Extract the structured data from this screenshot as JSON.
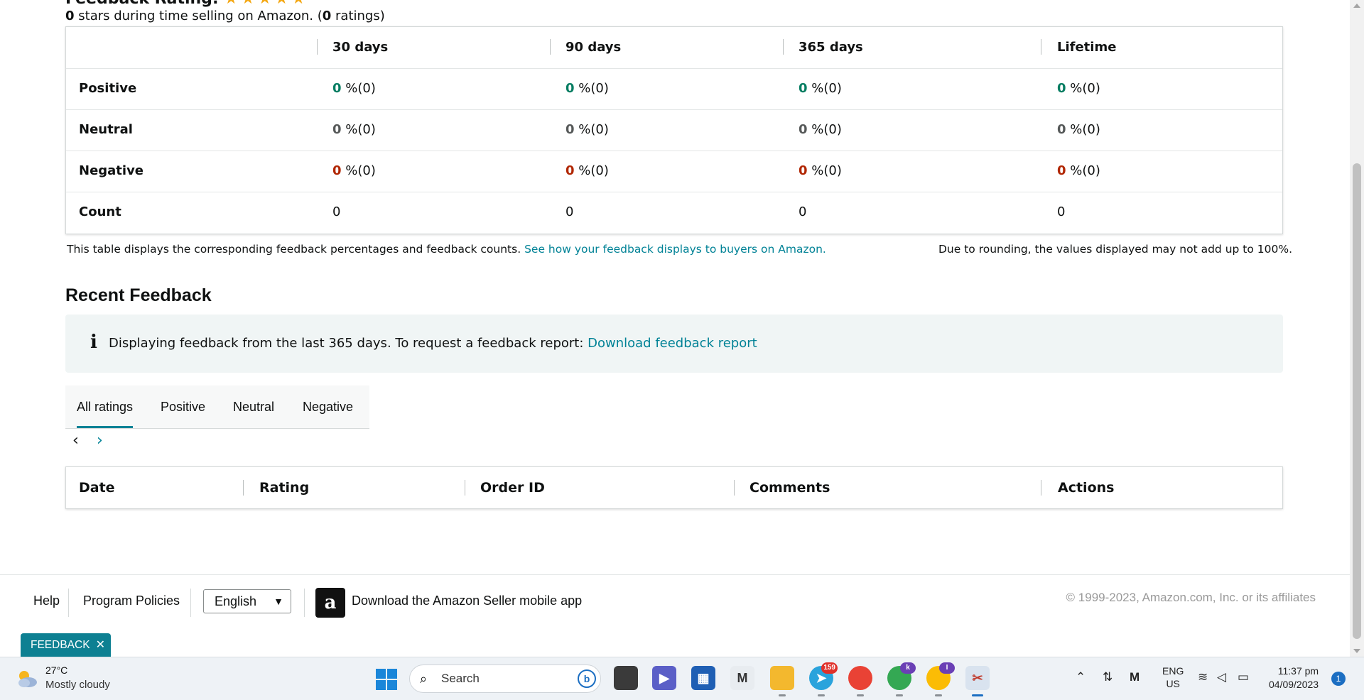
{
  "rating": {
    "title": "Feedback Rating:",
    "stars": "★★★★★",
    "stars_value": 0,
    "summary_count": "0",
    "summary_text1": " stars during time selling on Amazon. (",
    "summary_ratings": "0",
    "summary_text2": " ratings)"
  },
  "feedback_table": {
    "headers": [
      "30 days",
      "90 days",
      "365 days",
      "Lifetime"
    ],
    "rows": [
      {
        "label": "Positive",
        "cells": [
          {
            "v": "0",
            "s": " %(0)"
          },
          {
            "v": "0",
            "s": " %(0)"
          },
          {
            "v": "0",
            "s": " %(0)"
          },
          {
            "v": "0",
            "s": " %(0)"
          }
        ]
      },
      {
        "label": "Neutral",
        "cells": [
          {
            "v": "0",
            "s": " %(0)"
          },
          {
            "v": "0",
            "s": " %(0)"
          },
          {
            "v": "0",
            "s": " %(0)"
          },
          {
            "v": "0",
            "s": " %(0)"
          }
        ]
      },
      {
        "label": "Negative",
        "cells": [
          {
            "v": "0",
            "s": " %(0)"
          },
          {
            "v": "0",
            "s": " %(0)"
          },
          {
            "v": "0",
            "s": " %(0)"
          },
          {
            "v": "0",
            "s": " %(0)"
          }
        ]
      },
      {
        "label": "Count",
        "cells": [
          "0",
          "0",
          "0",
          "0"
        ]
      }
    ],
    "note": "This table displays the corresponding feedback percentages and feedback counts. ",
    "note_link": "See how your feedback displays to buyers on Amazon.",
    "rounding_note": "Due to rounding, the values displayed may not add up to 100%."
  },
  "recent": {
    "title": "Recent Feedback",
    "info_icon": "i",
    "info_text": "Displaying feedback from the last 365 days. To request a feedback report: ",
    "info_link": "Download feedback report",
    "tabs": [
      "All ratings",
      "Positive",
      "Neutral",
      "Negative"
    ],
    "prev": "‹",
    "next": "›",
    "columns": [
      "Date",
      "Rating",
      "Order ID",
      "Comments",
      "Actions"
    ]
  },
  "footer": {
    "help": "Help",
    "policies": "Program Policies",
    "language": "English",
    "app_logo": "a",
    "app_text": "Download the Amazon Seller mobile app",
    "copyright": "© 1999-2023, Amazon.com, Inc. or its affiliates"
  },
  "feedback_tag": {
    "label": "FEEDBACK",
    "close": "✕"
  },
  "taskbar": {
    "temp": "27°C",
    "weather": "Mostly cloudy",
    "search_placeholder": "Search",
    "bing": "b",
    "telegram_badge": "159",
    "chrome2_badge": "k",
    "chrome3_badge": "I",
    "lang_top": "ENG",
    "lang_bottom": "US",
    "time": "11:37 pm",
    "date": "04/09/2023",
    "notifications": "1"
  }
}
